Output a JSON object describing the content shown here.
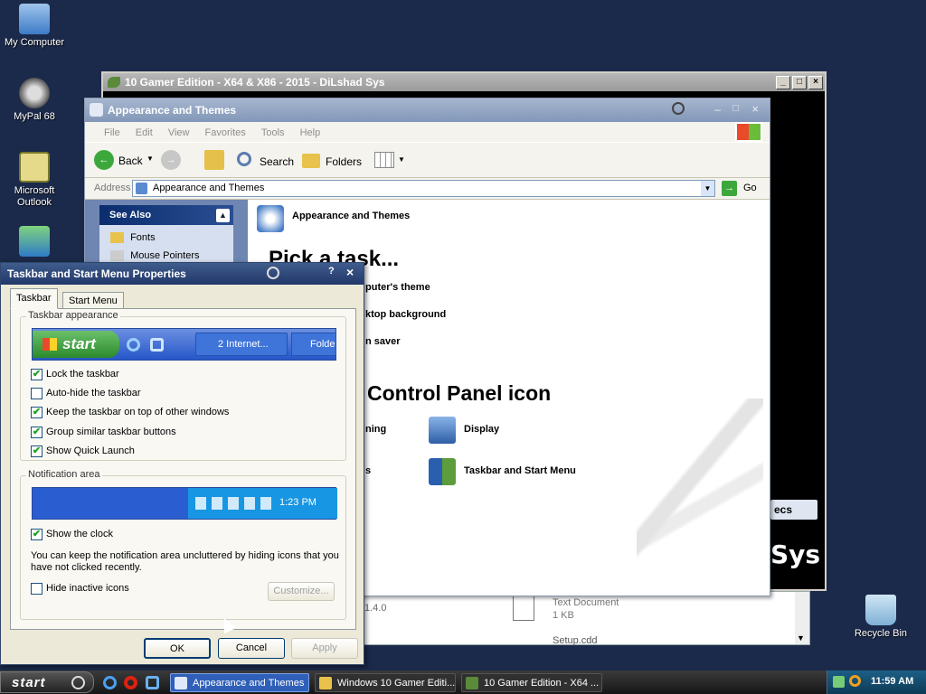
{
  "desktop": {
    "icons": [
      {
        "label": "My Computer"
      },
      {
        "label": "MyPal 68"
      },
      {
        "label": "Microsoft Outlook"
      },
      {
        "label": "Recycle Bin"
      }
    ]
  },
  "gamer_window": {
    "title": "10 Gamer Edition - X64 & X86 - 2015 - DiLshad Sys",
    "specs_text": "ecs",
    "sys_text": "Sys",
    "file_items": [
      {
        "name": "Text Document",
        "meta": "1 KB"
      },
      {
        "name": "Setup.cdd",
        "meta": ""
      }
    ],
    "partial_version": "1.4.0"
  },
  "appearance_window": {
    "title": "Appearance and Themes",
    "menu": [
      "File",
      "Edit",
      "View",
      "Favorites",
      "Tools",
      "Help"
    ],
    "toolbar": {
      "back": "Back",
      "search": "Search",
      "folders": "Folders"
    },
    "address_label": "Address",
    "address_value": "Appearance and Themes",
    "go_label": "Go",
    "see_also": {
      "title": "See Also",
      "items": [
        "Fonts",
        "Mouse Pointers"
      ]
    },
    "header_title": "Appearance and Themes",
    "pick_task": "Pick a task...",
    "tasks": [
      "puter's theme",
      "ktop background",
      "n saver"
    ],
    "pick_icon": "Control Panel icon",
    "icons": [
      {
        "label": "ning"
      },
      {
        "label": "Display"
      },
      {
        "label": "s"
      },
      {
        "label": "Taskbar and Start Menu"
      }
    ]
  },
  "dialog": {
    "title": "Taskbar and Start Menu Properties",
    "help": "?",
    "close": "×",
    "tabs": [
      "Taskbar",
      "Start Menu"
    ],
    "appearance_group": "Taskbar appearance",
    "preview": {
      "start": "start",
      "internet": "2 Internet...",
      "folder": "Folde"
    },
    "options": [
      {
        "label": "Lock the taskbar",
        "checked": true
      },
      {
        "label": "Auto-hide the taskbar",
        "checked": false
      },
      {
        "label": "Keep the taskbar on top of other windows",
        "checked": true
      },
      {
        "label": "Group similar taskbar buttons",
        "checked": true
      },
      {
        "label": "Show Quick Launch",
        "checked": true
      }
    ],
    "notification_group": "Notification area",
    "preview_time": "1:23 PM",
    "show_clock": {
      "label": "Show the clock",
      "checked": true
    },
    "info": "You can keep the notification area uncluttered by hiding icons that you have not clicked recently.",
    "hide_inactive": {
      "label": "Hide inactive icons",
      "checked": false
    },
    "customize": "Customize...",
    "ok": "OK",
    "cancel": "Cancel",
    "apply": "Apply"
  },
  "taskbar": {
    "start": "start",
    "items": [
      "Appearance and Themes",
      "Windows 10 Gamer Editi...",
      "10 Gamer Edition - X64 ..."
    ],
    "clock": "11:59 AM"
  }
}
